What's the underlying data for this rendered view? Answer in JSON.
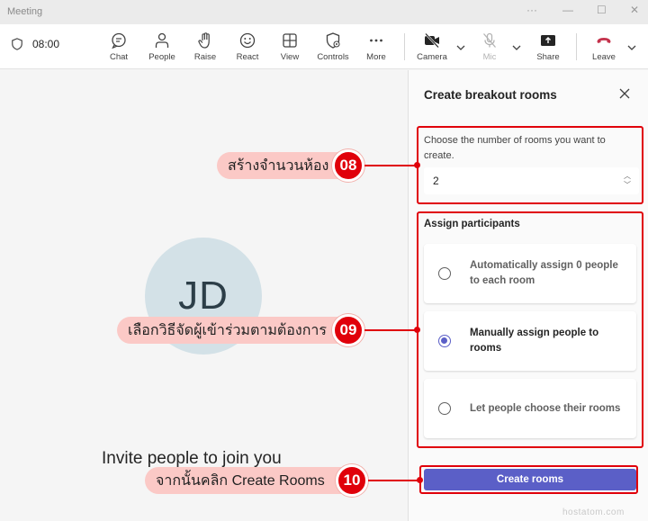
{
  "window": {
    "title": "Meeting",
    "controls": {
      "more": "···",
      "minimize": "—",
      "maximize": "☐",
      "close": "✕"
    }
  },
  "toolbar": {
    "timer": "08:00",
    "buttons": [
      {
        "label": "Chat",
        "icon": "chat-icon"
      },
      {
        "label": "People",
        "icon": "people-icon"
      },
      {
        "label": "Raise",
        "icon": "raise-hand-icon"
      },
      {
        "label": "React",
        "icon": "react-smiley-icon"
      },
      {
        "label": "View",
        "icon": "view-grid-icon"
      },
      {
        "label": "Controls",
        "icon": "controls-shield-icon"
      },
      {
        "label": "More",
        "icon": "more-dots-icon"
      },
      {
        "label": "Camera",
        "icon": "camera-off-icon"
      },
      {
        "label": "Mic",
        "icon": "mic-off-icon"
      },
      {
        "label": "Share",
        "icon": "share-icon"
      },
      {
        "label": "Leave",
        "icon": "leave-phone-icon"
      }
    ]
  },
  "stage": {
    "avatar_initials": "JD",
    "invite_text": "Invite people to join you"
  },
  "panel": {
    "title": "Create breakout rooms",
    "rooms_label": "Choose the number of rooms you want to create.",
    "rooms_value": "2",
    "assign_label": "Assign participants",
    "options": [
      {
        "label": "Automatically assign 0 people to each room",
        "selected": false
      },
      {
        "label": "Manually assign people to rooms",
        "selected": true
      },
      {
        "label": "Let people choose their rooms",
        "selected": false
      }
    ],
    "create_button": "Create rooms"
  },
  "annotations": [
    {
      "number": "08",
      "text": "สร้างจำนวนห้อง"
    },
    {
      "number": "09",
      "text": "เลือกวิธีจัดผู้เข้าร่วมตามต้องการ"
    },
    {
      "number": "10",
      "text": "จากนั้นคลิก Create Rooms"
    }
  ],
  "watermark": "hostatom.com",
  "colors": {
    "accent": "#5b5fc7",
    "annotation_red": "#e0000a",
    "annotation_pink": "#fbc9c6",
    "leave_red": "#c4314b",
    "avatar_bg": "#d3e1e7"
  }
}
